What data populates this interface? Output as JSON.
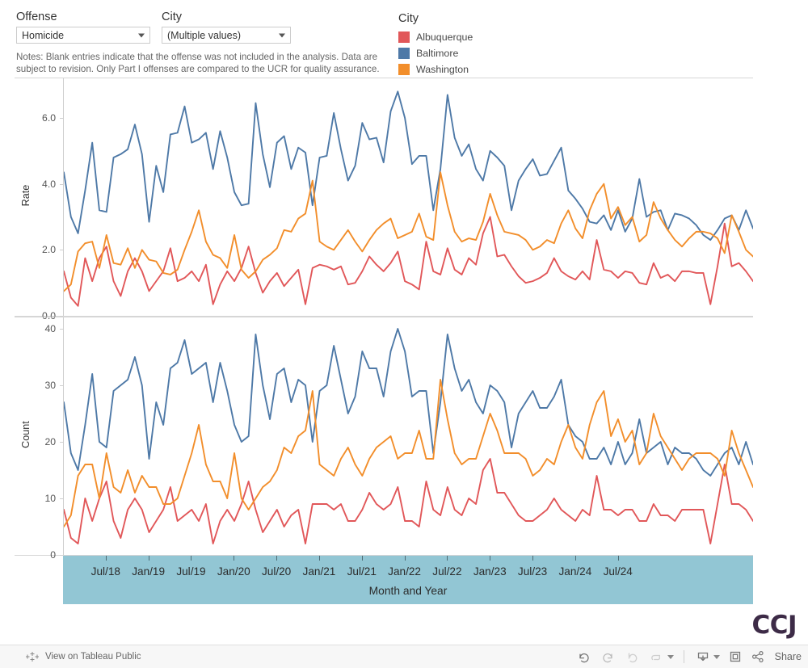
{
  "filters": {
    "offense": {
      "label": "Offense",
      "value": "Homicide"
    },
    "city": {
      "label": "City",
      "value": "(Multiple values)"
    },
    "notes": "Notes: Blank entries indicate that the offense was not included in the analysis. Data are subject to revision. Only Part I offenses are compared to the UCR for quality assurance."
  },
  "legend": {
    "title": "City",
    "items": [
      {
        "label": "Albuquerque",
        "color": "#E15759"
      },
      {
        "label": "Baltimore",
        "color": "#4E79A7"
      },
      {
        "label": "Washington",
        "color": "#F28E2B"
      }
    ]
  },
  "toolbar": {
    "view_on_tableau": "View on Tableau Public",
    "share": "Share",
    "undo": "Undo",
    "redo": "Redo",
    "revert": "Revert",
    "refresh": "Refresh",
    "download": "Download",
    "fullscreen": "Full Screen"
  },
  "branding": {
    "logo": "CCJ"
  },
  "chart_data": [
    {
      "type": "line",
      "title": "Rate",
      "ylabel": "Rate",
      "xlabel": "Month and Year",
      "ylim": [
        0,
        7.2
      ],
      "yticks": [
        0.0,
        2.0,
        4.0,
        6.0
      ],
      "ytick_labels": [
        "0.0",
        "2.0",
        "4.0",
        "6.0"
      ],
      "grid": false,
      "legend_position": "top-right",
      "x_start": "2018-01",
      "x_end": "2024-12",
      "xtick_labels": [
        "Jul/18",
        "Jan/19",
        "Jul/19",
        "Jan/20",
        "Jul/20",
        "Jan/21",
        "Jul/21",
        "Jan/22",
        "Jul/22",
        "Jan/23",
        "Jul/23",
        "Jan/24",
        "Jul/24"
      ],
      "series": [
        {
          "name": "Albuquerque",
          "color": "#E15759",
          "values": [
            1.35,
            0.55,
            0.3,
            1.75,
            1.05,
            1.75,
            2.1,
            1.05,
            0.6,
            1.35,
            1.75,
            1.35,
            0.75,
            1.05,
            1.35,
            2.05,
            1.05,
            1.15,
            1.35,
            1.05,
            1.55,
            0.35,
            0.95,
            1.35,
            1.05,
            1.45,
            2.1,
            1.3,
            0.7,
            1.05,
            1.3,
            0.9,
            1.15,
            1.4,
            0.35,
            1.45,
            1.55,
            1.5,
            1.4,
            1.5,
            0.95,
            1.0,
            1.35,
            1.8,
            1.55,
            1.35,
            1.6,
            1.95,
            1.05,
            0.95,
            0.8,
            2.25,
            1.35,
            1.25,
            2.05,
            1.4,
            1.25,
            1.75,
            1.55,
            2.5,
            3.0,
            1.8,
            1.85,
            1.5,
            1.2,
            1.0,
            1.05,
            1.15,
            1.3,
            1.75,
            1.35,
            1.2,
            1.1,
            1.35,
            1.1,
            2.3,
            1.4,
            1.35,
            1.15,
            1.35,
            1.3,
            1.0,
            0.95,
            1.6,
            1.15,
            1.25,
            1.05,
            1.35,
            1.35,
            1.3,
            1.3,
            0.35,
            1.5,
            2.8,
            1.5,
            1.6,
            1.35,
            1.05
          ]
        },
        {
          "name": "Baltimore",
          "color": "#4E79A7",
          "values": [
            4.35,
            3.0,
            2.5,
            3.8,
            5.25,
            3.2,
            3.15,
            4.8,
            4.9,
            5.05,
            5.8,
            4.9,
            2.85,
            4.55,
            3.75,
            5.5,
            5.55,
            6.35,
            5.25,
            5.35,
            5.55,
            4.45,
            5.6,
            4.8,
            3.75,
            3.35,
            3.4,
            6.45,
            4.9,
            3.9,
            5.25,
            5.45,
            4.45,
            5.1,
            4.95,
            3.35,
            4.8,
            4.85,
            6.15,
            5.05,
            4.1,
            4.55,
            5.85,
            5.35,
            5.4,
            4.65,
            6.2,
            6.8,
            6.0,
            4.6,
            4.85,
            4.85,
            3.2,
            4.45,
            6.7,
            5.4,
            4.85,
            5.2,
            4.45,
            4.1,
            5.0,
            4.8,
            4.55,
            3.2,
            4.1,
            4.45,
            4.75,
            4.25,
            4.3,
            4.7,
            5.1,
            3.8,
            3.55,
            3.25,
            2.85,
            2.8,
            3.05,
            2.6,
            3.2,
            2.55,
            2.95,
            4.15,
            3.0,
            3.15,
            3.2,
            2.6,
            3.1,
            3.05,
            2.95,
            2.75,
            2.45,
            2.3,
            2.6,
            2.95,
            3.05,
            2.6,
            3.2,
            2.65
          ]
        },
        {
          "name": "Washington",
          "color": "#F28E2B",
          "values": [
            0.75,
            0.95,
            1.95,
            2.2,
            2.25,
            1.45,
            2.45,
            1.6,
            1.55,
            2.05,
            1.45,
            2.0,
            1.7,
            1.65,
            1.3,
            1.25,
            1.4,
            2.0,
            2.55,
            3.2,
            2.25,
            1.85,
            1.75,
            1.45,
            2.45,
            1.4,
            1.15,
            1.35,
            1.7,
            1.85,
            2.05,
            2.6,
            2.55,
            2.95,
            3.1,
            4.1,
            2.25,
            2.1,
            2.0,
            2.3,
            2.6,
            2.25,
            1.95,
            2.3,
            2.6,
            2.8,
            2.95,
            2.35,
            2.45,
            2.55,
            3.1,
            2.4,
            2.3,
            4.35,
            3.35,
            2.55,
            2.25,
            2.35,
            2.3,
            2.85,
            3.7,
            3.05,
            2.55,
            2.5,
            2.45,
            2.3,
            2.0,
            2.1,
            2.3,
            2.2,
            2.8,
            3.2,
            2.65,
            2.35,
            3.2,
            3.7,
            4.0,
            2.95,
            3.3,
            2.75,
            3.0,
            2.25,
            2.45,
            3.45,
            2.95,
            2.6,
            2.3,
            2.1,
            2.35,
            2.55,
            2.55,
            2.5,
            2.35,
            1.9,
            3.05,
            2.55,
            2.0,
            1.8
          ]
        }
      ]
    },
    {
      "type": "line",
      "title": "Count",
      "ylabel": "Count",
      "xlabel": "Month and Year",
      "ylim": [
        0,
        42
      ],
      "yticks": [
        0,
        10,
        20,
        30,
        40
      ],
      "ytick_labels": [
        "0",
        "10",
        "20",
        "30",
        "40"
      ],
      "grid": false,
      "legend_position": "top-right",
      "x_start": "2018-01",
      "x_end": "2024-12",
      "xtick_labels": [
        "Jul/18",
        "Jan/19",
        "Jul/19",
        "Jan/20",
        "Jul/20",
        "Jan/21",
        "Jul/21",
        "Jan/22",
        "Jul/22",
        "Jan/23",
        "Jul/23",
        "Jan/24",
        "Jul/24"
      ],
      "series": [
        {
          "name": "Albuquerque",
          "color": "#E15759",
          "values": [
            8,
            3,
            2,
            10,
            6,
            10,
            13,
            6,
            3,
            8,
            10,
            8,
            4,
            6,
            8,
            12,
            6,
            7,
            8,
            6,
            9,
            2,
            6,
            8,
            6,
            9,
            13,
            8,
            4,
            6,
            8,
            5,
            7,
            8,
            2,
            9,
            9,
            9,
            8,
            9,
            6,
            6,
            8,
            11,
            9,
            8,
            9,
            12,
            6,
            6,
            5,
            13,
            8,
            7,
            12,
            8,
            7,
            10,
            9,
            15,
            17,
            11,
            11,
            9,
            7,
            6,
            6,
            7,
            8,
            10,
            8,
            7,
            6,
            8,
            7,
            14,
            8,
            8,
            7,
            8,
            8,
            6,
            6,
            9,
            7,
            7,
            6,
            8,
            8,
            8,
            8,
            2,
            9,
            16,
            9,
            9,
            8,
            6
          ]
        },
        {
          "name": "Baltimore",
          "color": "#4E79A7",
          "values": [
            27,
            18,
            15,
            23,
            32,
            20,
            19,
            29,
            30,
            31,
            35,
            30,
            17,
            27,
            23,
            33,
            34,
            38,
            32,
            33,
            34,
            27,
            34,
            29,
            23,
            20,
            21,
            39,
            30,
            24,
            32,
            33,
            27,
            31,
            30,
            20,
            29,
            30,
            37,
            31,
            25,
            28,
            36,
            33,
            33,
            28,
            36,
            40,
            36,
            28,
            29,
            29,
            18,
            27,
            39,
            33,
            29,
            31,
            27,
            25,
            30,
            29,
            27,
            19,
            25,
            27,
            29,
            26,
            26,
            28,
            31,
            23,
            21,
            20,
            17,
            17,
            19,
            16,
            20,
            16,
            18,
            24,
            18,
            19,
            20,
            16,
            19,
            18,
            18,
            17,
            15,
            14,
            16,
            18,
            19,
            16,
            20,
            16
          ]
        },
        {
          "name": "Washington",
          "color": "#F28E2B",
          "values": [
            5,
            7,
            14,
            16,
            16,
            10,
            18,
            12,
            11,
            15,
            11,
            14,
            12,
            12,
            9,
            9,
            10,
            14,
            18,
            23,
            16,
            13,
            13,
            10,
            18,
            10,
            8,
            10,
            12,
            13,
            15,
            19,
            18,
            21,
            22,
            29,
            16,
            15,
            14,
            17,
            19,
            16,
            14,
            17,
            19,
            20,
            21,
            17,
            18,
            18,
            22,
            17,
            17,
            31,
            24,
            18,
            16,
            17,
            17,
            21,
            25,
            22,
            18,
            18,
            18,
            17,
            14,
            15,
            17,
            16,
            20,
            23,
            19,
            17,
            23,
            27,
            29,
            21,
            24,
            20,
            22,
            16,
            18,
            25,
            21,
            19,
            17,
            15,
            17,
            18,
            18,
            18,
            17,
            14,
            22,
            18,
            15,
            12
          ]
        }
      ]
    }
  ]
}
